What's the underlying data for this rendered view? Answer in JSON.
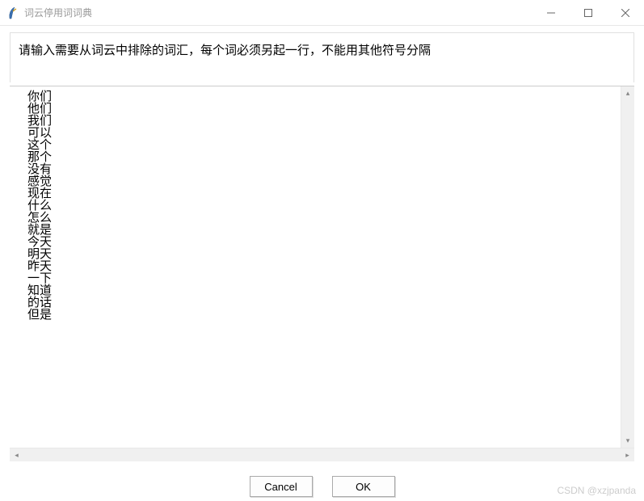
{
  "window": {
    "title": "词云停用词词典"
  },
  "instruction": "请输入需要从词云中排除的词汇，每个词必须另起一行，不能用其他符号分隔",
  "stopwords": [
    "你们",
    "他们",
    "我们",
    "可以",
    "这个",
    "那个",
    "没有",
    "感觉",
    "现在",
    "什么",
    "怎么",
    "就是",
    "今天",
    "明天",
    "昨天",
    "一下",
    "知道",
    "的话",
    "但是"
  ],
  "buttons": {
    "cancel": "Cancel",
    "ok": "OK"
  },
  "watermark": "CSDN @xzjpanda"
}
